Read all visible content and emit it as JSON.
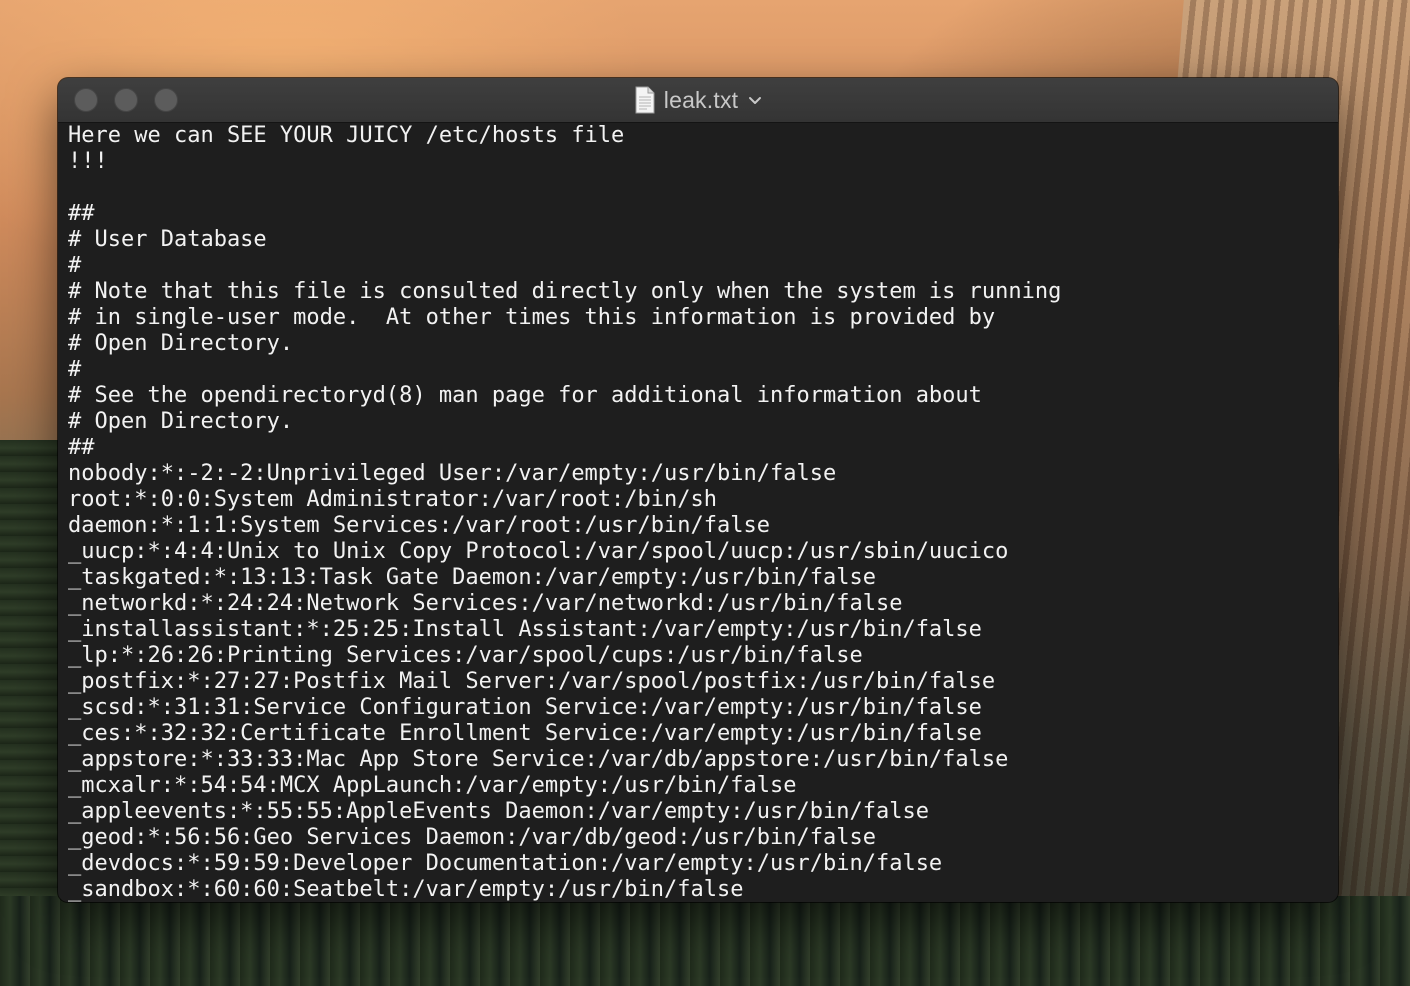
{
  "window": {
    "title": "leak.txt",
    "file_icon": "text-document-icon",
    "menu_icon": "chevron-down-icon"
  },
  "editor": {
    "lines": [
      "Here we can SEE YOUR JUICY /etc/hosts file",
      "!!!",
      "",
      "##",
      "# User Database",
      "#",
      "# Note that this file is consulted directly only when the system is running",
      "# in single-user mode.  At other times this information is provided by",
      "# Open Directory.",
      "#",
      "# See the opendirectoryd(8) man page for additional information about",
      "# Open Directory.",
      "##",
      "nobody:*:-2:-2:Unprivileged User:/var/empty:/usr/bin/false",
      "root:*:0:0:System Administrator:/var/root:/bin/sh",
      "daemon:*:1:1:System Services:/var/root:/usr/bin/false",
      "_uucp:*:4:4:Unix to Unix Copy Protocol:/var/spool/uucp:/usr/sbin/uucico",
      "_taskgated:*:13:13:Task Gate Daemon:/var/empty:/usr/bin/false",
      "_networkd:*:24:24:Network Services:/var/networkd:/usr/bin/false",
      "_installassistant:*:25:25:Install Assistant:/var/empty:/usr/bin/false",
      "_lp:*:26:26:Printing Services:/var/spool/cups:/usr/bin/false",
      "_postfix:*:27:27:Postfix Mail Server:/var/spool/postfix:/usr/bin/false",
      "_scsd:*:31:31:Service Configuration Service:/var/empty:/usr/bin/false",
      "_ces:*:32:32:Certificate Enrollment Service:/var/empty:/usr/bin/false",
      "_appstore:*:33:33:Mac App Store Service:/var/db/appstore:/usr/bin/false",
      "_mcxalr:*:54:54:MCX AppLaunch:/var/empty:/usr/bin/false",
      "_appleevents:*:55:55:AppleEvents Daemon:/var/empty:/usr/bin/false",
      "_geod:*:56:56:Geo Services Daemon:/var/db/geod:/usr/bin/false",
      "_devdocs:*:59:59:Developer Documentation:/var/empty:/usr/bin/false",
      "_sandbox:*:60:60:Seatbelt:/var/empty:/usr/bin/false"
    ]
  },
  "colors": {
    "text": "#f2f2f2",
    "editor_background": "#1e1e1e",
    "titlebar": "#3a3a3a",
    "traffic_light": "#5c5c5c"
  }
}
